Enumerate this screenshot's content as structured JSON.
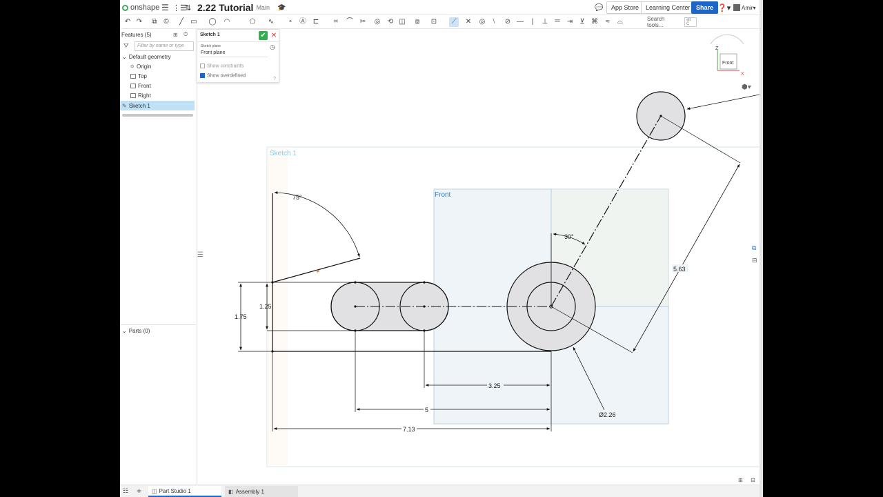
{
  "app": {
    "brand": "onshape",
    "doc_title": "2.22 Tutorial",
    "branch": "Main",
    "app_store": "App Store",
    "learning_center": "Learning Center",
    "share": "Share",
    "user": "Amir"
  },
  "toolbar": {
    "search_placeholder": "Search tools...",
    "search_shortcut": "alt C"
  },
  "features": {
    "header": "Features (5)",
    "filter_placeholder": "Filter by name or type",
    "group": "Default geometry",
    "items": [
      "Origin",
      "Top",
      "Front",
      "Right"
    ],
    "selected": "Sketch 1",
    "parts": "Parts (0)"
  },
  "sketch_dialog": {
    "title": "Sketch 1",
    "plane_label": "Sketch plane",
    "plane_value": "Front plane",
    "show_constraints": "Show constraints",
    "show_overdefined": "Show overdefined"
  },
  "canvas": {
    "sketch_label": "Sketch 1",
    "plane_label": "Front",
    "view_cube_label": "Front",
    "axis_z": "Z",
    "axis_x": "X",
    "dimensions": {
      "angle_75": "75°",
      "angle_30": "30°",
      "d_125": "1.25",
      "d_175": "1.75",
      "d_325": "3.25",
      "d_5": "5",
      "d_713": "7.13",
      "d_563": "5.63",
      "d_diam": "Ø2.26"
    }
  },
  "tabs": [
    "Part Studio 1",
    "Assembly 1"
  ]
}
